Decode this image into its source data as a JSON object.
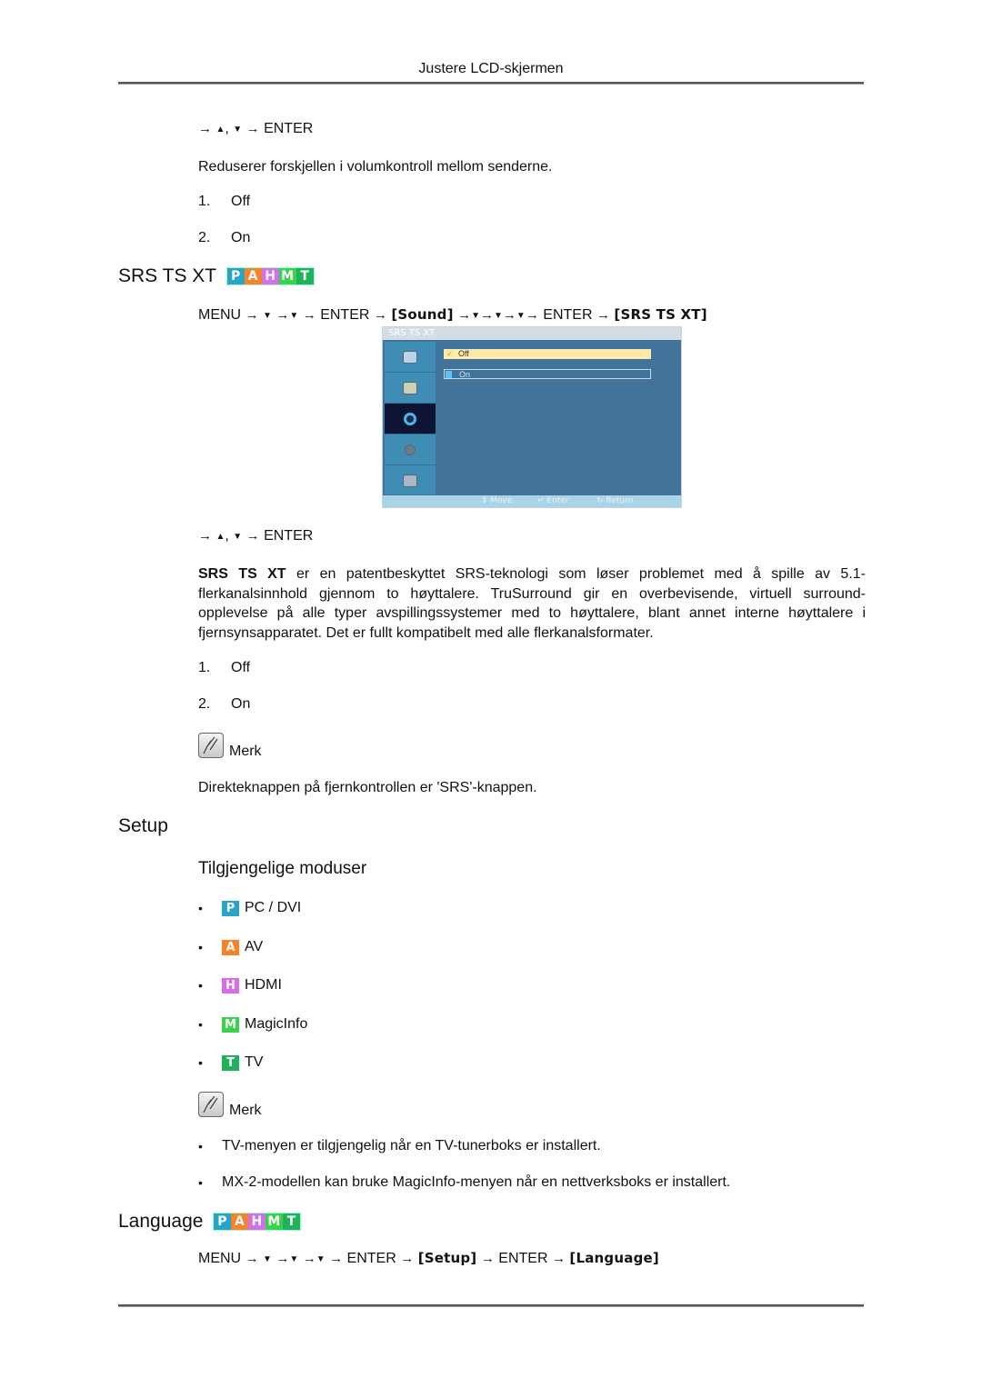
{
  "header": {
    "title": "Justere LCD-skjermen"
  },
  "colors": {
    "badge_p": "#2aa3c8",
    "badge_a": "#f7822a",
    "badge_h": "#d56ee8",
    "badge_m": "#3ad24a",
    "badge_t": "#22b05a",
    "osd_bg": "#42739b",
    "osd_selected": "#fde9a9"
  },
  "top_section": {
    "nav": {
      "arrow": "→",
      "up": "▲",
      "sep": ",",
      "down": "▼",
      "enter": "ENTER"
    },
    "description": "Reduserer forskjellen i volumkontroll mellom senderne.",
    "options": [
      {
        "num": "1.",
        "label": "Off"
      },
      {
        "num": "2.",
        "label": "On"
      }
    ]
  },
  "srs": {
    "title": "SRS TS XT",
    "badges": [
      "P",
      "A",
      "H",
      "M",
      "T"
    ],
    "nav_path": {
      "menu": "MENU",
      "arrow": "→",
      "down": "▼",
      "enter": "ENTER",
      "sound": "[Sound]",
      "target": "[SRS TS XT]"
    },
    "osd": {
      "title": "SRS TS XT",
      "sidebar_icons": [
        "picture-icon",
        "sound-setup-icon",
        "sound-icon",
        "setup-gear-icon",
        "multi-control-icon"
      ],
      "options": [
        {
          "label": "Off",
          "selected": true
        },
        {
          "label": "On",
          "selected": false
        }
      ],
      "footer": {
        "move": "Move",
        "enter": "Enter",
        "return": "Return"
      }
    },
    "nav2": {
      "arrow": "→",
      "up": "▲",
      "sep": ",",
      "down": "▼",
      "enter": "ENTER"
    },
    "description_bold": "SRS TS XT",
    "description_rest": " er en patentbeskyttet SRS-teknologi som løser problemet med å spille av 5.1-flerkanalsinnhold gjennom to høyttalere. TruSurround gir en overbevisende, virtuell surround-opplevelse på alle typer avspillingssystemer med to høyttalere, blant annet interne høyttalere i fjernsynsapparatet. Det er fullt kompatibelt med alle flerkanalsformater.",
    "options": [
      {
        "num": "1.",
        "label": "Off"
      },
      {
        "num": "2.",
        "label": "On"
      }
    ],
    "note_label": "Merk",
    "note_text": "Direkteknappen på fjernkontrollen er 'SRS'-knappen."
  },
  "setup": {
    "title": "Setup",
    "subtitle": "Tilgjengelige moduser",
    "modes": [
      {
        "badge": "P",
        "label": "PC / DVI"
      },
      {
        "badge": "A",
        "label": "AV"
      },
      {
        "badge": "H",
        "label": "HDMI"
      },
      {
        "badge": "M",
        "label": "MagicInfo"
      },
      {
        "badge": "T",
        "label": "TV"
      }
    ],
    "bullet": "•",
    "note_label": "Merk",
    "notes": [
      {
        "bold": "TV",
        "rest": "-menyen er tilgjengelig når en TV-tunerboks er installert."
      },
      {
        "pre": "MX-2-modellen kan bruke ",
        "bold": "MagicInfo",
        "rest": "-menyen når en nettverksboks er installert."
      }
    ]
  },
  "language": {
    "title": "Language",
    "badges": [
      "P",
      "A",
      "H",
      "M",
      "T"
    ],
    "nav_path": {
      "menu": "MENU",
      "arrow": "→",
      "down": "▼",
      "enter": "ENTER",
      "setup": "[Setup]",
      "target": "[Language]"
    }
  }
}
